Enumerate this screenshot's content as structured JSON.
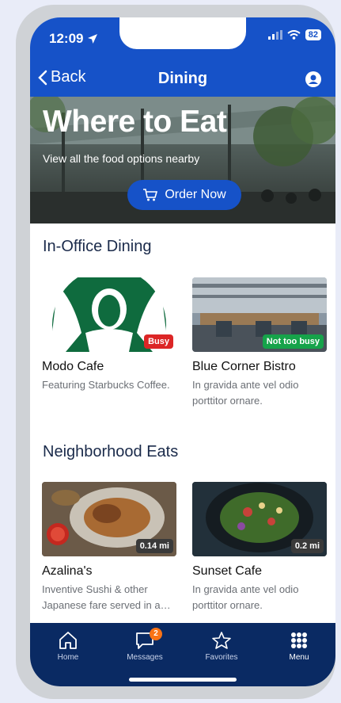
{
  "status": {
    "time": "12:09",
    "battery": "82"
  },
  "nav": {
    "back_label": "Back",
    "title": "Dining"
  },
  "hero": {
    "title": "Where to Eat",
    "subtitle": "View all the food options nearby",
    "order_label": "Order Now"
  },
  "sections": [
    {
      "title": "In-Office Dining",
      "cards": [
        {
          "name": "Modo Cafe",
          "desc": "Featuring Starbucks Coffee.",
          "badge": "Busy"
        },
        {
          "name": "Blue Corner Bistro",
          "desc": "In gravida ante vel odio porttitor ornare.",
          "badge": "Not too busy"
        }
      ]
    },
    {
      "title": "Neighborhood Eats",
      "cards": [
        {
          "name": "Azalina's",
          "desc": "Inventive Sushi & other Japanese fare served in a…",
          "badge": "0.14 mi"
        },
        {
          "name": "Sunset Cafe",
          "desc": "In gravida ante vel odio porttitor ornare.",
          "badge": "0.2 mi"
        }
      ]
    }
  ],
  "tabs": [
    {
      "label": "Home",
      "icon": "home-icon"
    },
    {
      "label": "Messages",
      "icon": "chat-icon",
      "badge": "2"
    },
    {
      "label": "Favorites",
      "icon": "star-icon"
    },
    {
      "label": "Menu",
      "icon": "grid-icon"
    }
  ],
  "colors": {
    "primary": "#1652c8",
    "tabbar": "#0a2a63",
    "busy": "#dc2626",
    "ok": "#16a34a",
    "badge_orange": "#f97316"
  }
}
